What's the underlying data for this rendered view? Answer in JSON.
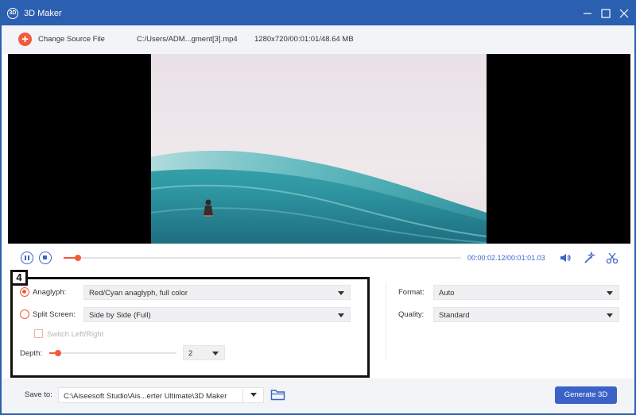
{
  "window": {
    "title": "3D Maker",
    "logo_text": "3D"
  },
  "toolbar": {
    "change_source_label": "Change Source File",
    "file_path": "C:/Users/ADM...gment[3].mp4",
    "file_info": "1280x720/00:01:01/48.64 MB"
  },
  "playback": {
    "current_time": "00:00:02.12",
    "total_time": "/00:01:01.03",
    "progress_fraction": 0.035
  },
  "settings": {
    "step_number": "4",
    "anaglyph": {
      "label": "Anaglyph:",
      "selected": true,
      "value": "Red/Cyan anaglyph, full color"
    },
    "split_screen": {
      "label": "Split Screen:",
      "selected": false,
      "value": "Side by Side (Full)"
    },
    "switch_left_right": {
      "label": "Switch Left/Right",
      "checked": false,
      "enabled": false
    },
    "depth": {
      "label": "Depth:",
      "value": "2",
      "slider_fraction": 0.07
    },
    "format": {
      "label": "Format:",
      "value": "Auto"
    },
    "quality": {
      "label": "Quality:",
      "value": "Standard"
    }
  },
  "bottom": {
    "save_to_label": "Save to:",
    "save_path": "C:\\Aiseesoft Studio\\Ais...erter Ultimate\\3D Maker",
    "generate_label": "Generate 3D"
  },
  "colors": {
    "title_bar": "#2b5fb0",
    "accent_orange": "#f35a3a",
    "accent_blue": "#3b63c7"
  },
  "icons": [
    "app-logo-icon",
    "minimize-icon",
    "maximize-icon",
    "close-icon",
    "add-icon",
    "pause-icon",
    "stop-icon",
    "volume-icon",
    "magic-wand-icon",
    "scissors-icon",
    "folder-icon",
    "chevron-down-icon"
  ]
}
